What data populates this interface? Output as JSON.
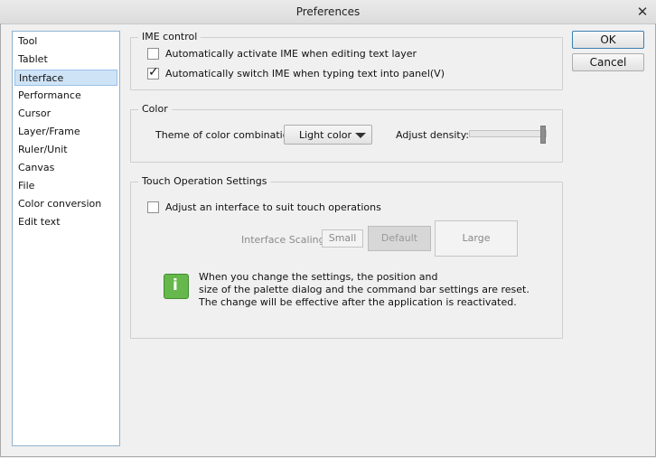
{
  "window": {
    "title": "Preferences",
    "close_glyph": "✕"
  },
  "sidebar": {
    "items": [
      {
        "label": "Tool"
      },
      {
        "label": "Tablet"
      },
      {
        "label": "Interface",
        "selected": true
      },
      {
        "label": "Performance"
      },
      {
        "label": "Cursor"
      },
      {
        "label": "Layer/Frame"
      },
      {
        "label": "Ruler/Unit"
      },
      {
        "label": "Canvas"
      },
      {
        "label": "File"
      },
      {
        "label": "Color conversion"
      },
      {
        "label": "Edit text"
      }
    ]
  },
  "ime": {
    "legend": "IME control",
    "auto_activate": {
      "label": "Automatically activate IME when editing text layer",
      "checked": false
    },
    "auto_switch": {
      "label": "Automatically switch IME when typing text into panel(V)",
      "checked": true
    }
  },
  "color": {
    "legend": "Color",
    "theme_label": "Theme of color combination:",
    "theme_value": "Light color",
    "density_label": "Adjust density:",
    "density_level": 1.0
  },
  "touch": {
    "legend": "Touch Operation Settings",
    "adjust": {
      "label": "Adjust an interface to suit touch operations",
      "checked": false
    },
    "scaling_label": "Interface Scaling:",
    "scale_small": "Small",
    "scale_default": "Default",
    "scale_large": "Large",
    "info_lines": [
      "When you change the settings, the position and",
      "size of the palette dialog and the command bar settings are reset.",
      "The change will be effective after the application is reactivated."
    ]
  },
  "buttons": {
    "ok": "OK",
    "cancel": "Cancel"
  },
  "colors": {
    "selection_bg": "#cfe3f7",
    "info_green": "#67b84c",
    "panel_bg": "#f0f0f0"
  }
}
